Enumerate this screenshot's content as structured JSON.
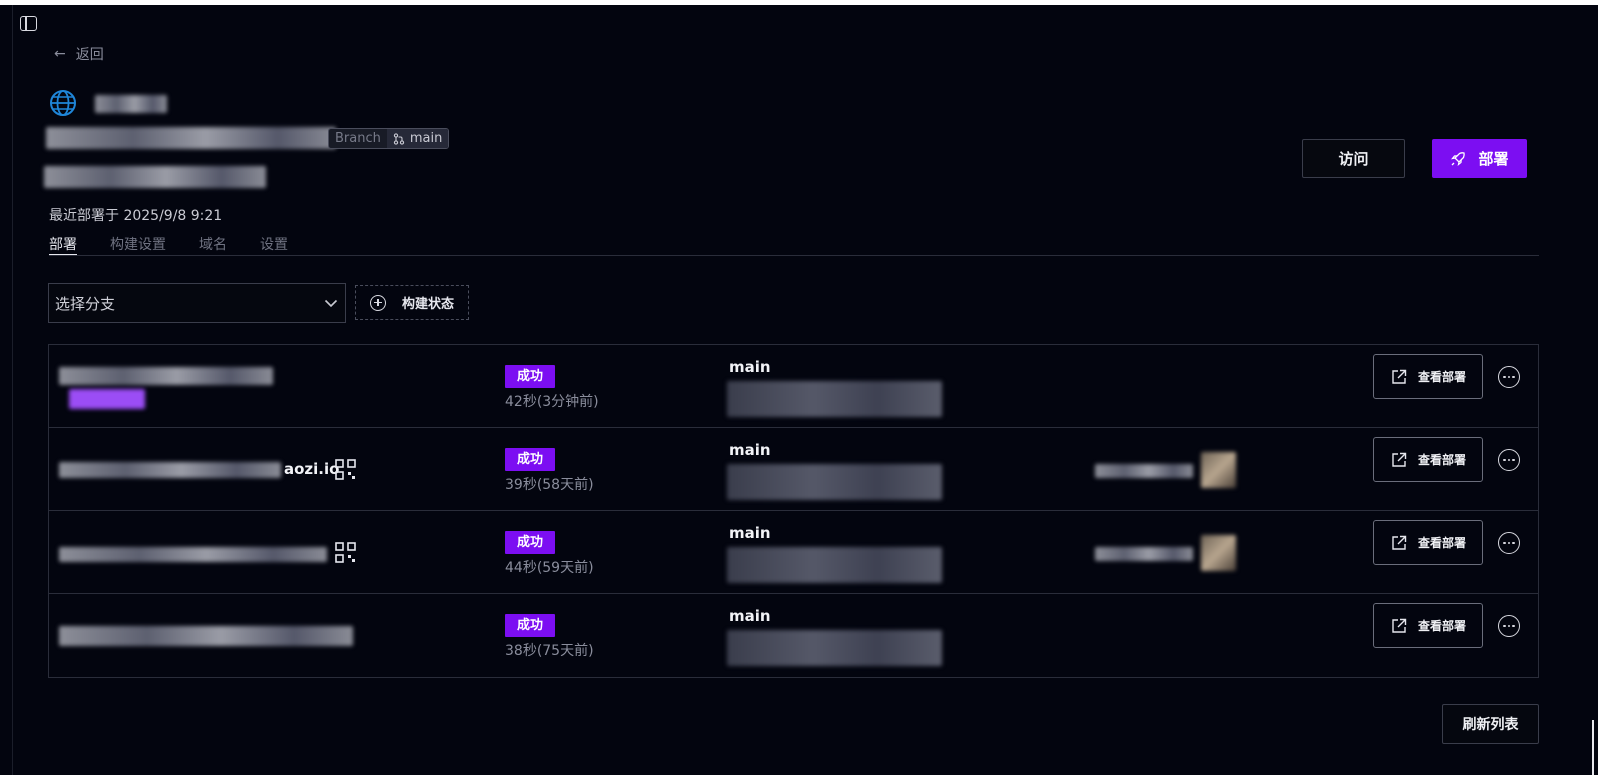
{
  "nav": {
    "back_label": "返回"
  },
  "project": {
    "branch_tag_label": "Branch",
    "branch_tag_value": "main",
    "last_deployed": "最近部署于 2025/9/8 9:21"
  },
  "tabs": [
    {
      "label": "部署",
      "active": true
    },
    {
      "label": "构建设置",
      "active": false
    },
    {
      "label": "域名",
      "active": false
    },
    {
      "label": "设置",
      "active": false
    }
  ],
  "actions": {
    "visit_label": "访问",
    "deploy_label": "部署"
  },
  "filters": {
    "branch_select_placeholder": "选择分支",
    "build_status_label": "构建状态"
  },
  "deployments": [
    {
      "status": "成功",
      "duration": "42秒(3分钟前)",
      "branch": "main",
      "view_label": "查看部署"
    },
    {
      "status": "成功",
      "duration": "39秒(58天前)",
      "branch": "main",
      "view_label": "查看部署",
      "url_suffix": "aozi.io"
    },
    {
      "status": "成功",
      "duration": "44秒(59天前)",
      "branch": "main",
      "view_label": "查看部署"
    },
    {
      "status": "成功",
      "duration": "38秒(75天前)",
      "branch": "main",
      "view_label": "查看部署"
    }
  ],
  "footer": {
    "refresh_label": "刷新列表"
  },
  "colors": {
    "accent": "#7c0ef2",
    "background": "#03050f",
    "border": "#2a2d3a"
  },
  "icons": [
    "sidebar-toggle-icon",
    "arrow-left-icon",
    "globe-icon",
    "git-branch-icon",
    "rocket-icon",
    "chevron-down-icon",
    "plus-circle-icon",
    "external-link-icon",
    "more-icon",
    "qr-code-icon"
  ]
}
